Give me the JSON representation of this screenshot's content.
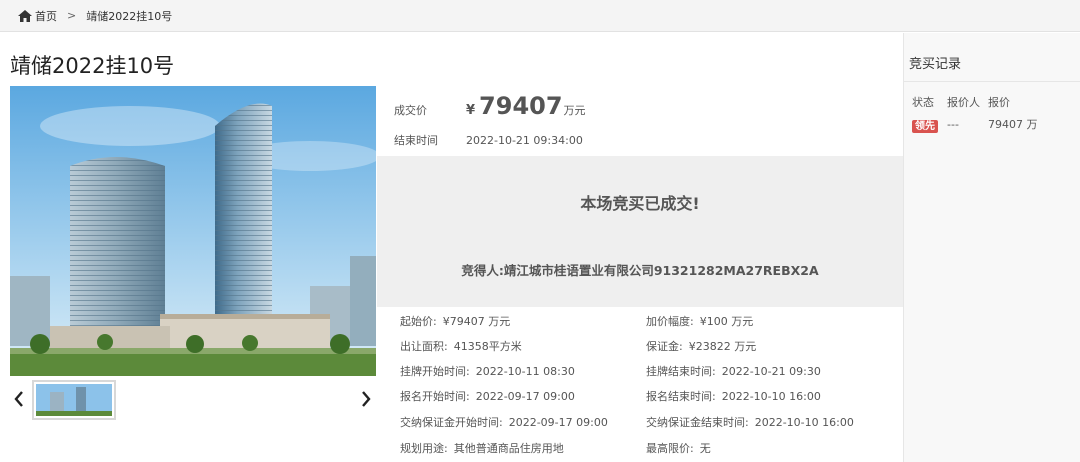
{
  "breadcrumb": {
    "home": "首页",
    "separator": ">",
    "current": "靖储2022挂10号"
  },
  "title": "靖储2022挂10号",
  "price": {
    "label": "成交价",
    "currency": "¥",
    "value": "79407",
    "unit": "万元"
  },
  "end_time": {
    "label": "结束时间",
    "value": "2022-10-21 09:34:00"
  },
  "result": {
    "title": "本场竞买已成交!",
    "winner_label": "竞得人:",
    "winner_value": "靖江城市桂语置业有限公司91321282MA27REBX2A"
  },
  "details": {
    "start_price": {
      "label": "起始价:",
      "value": "¥79407 万元"
    },
    "increment": {
      "label": "加价幅度:",
      "value": "¥100 万元"
    },
    "area": {
      "label": "出让面积:",
      "value": "41358平方米"
    },
    "deposit": {
      "label": "保证金:",
      "value": "¥23822 万元"
    },
    "listing_start": {
      "label": "挂牌开始时间:",
      "value": "2022-10-11 08:30"
    },
    "listing_end": {
      "label": "挂牌结束时间:",
      "value": "2022-10-21 09:30"
    },
    "signup_start": {
      "label": "报名开始时间:",
      "value": "2022-09-17 09:00"
    },
    "signup_end": {
      "label": "报名结束时间:",
      "value": "2022-10-10 16:00"
    },
    "deposit_start": {
      "label": "交纳保证金开始时间:",
      "value": "2022-09-17 09:00"
    },
    "deposit_end": {
      "label": "交纳保证金结束时间:",
      "value": "2022-10-10 16:00"
    },
    "usage": {
      "label": "规划用途:",
      "value": "其他普通商品住房用地"
    },
    "max_price": {
      "label": "最高限价:",
      "value": "无"
    }
  },
  "sidebar": {
    "title": "竞买记录",
    "headers": [
      "状态",
      "报价人",
      "报价"
    ],
    "rows": [
      {
        "status": "领先",
        "bidder": "---",
        "amount": "79407 万"
      }
    ]
  },
  "colors": {
    "badge": "#d9534f",
    "result_bg": "#efefef",
    "breadcrumb_bg": "#f4f4f4"
  }
}
